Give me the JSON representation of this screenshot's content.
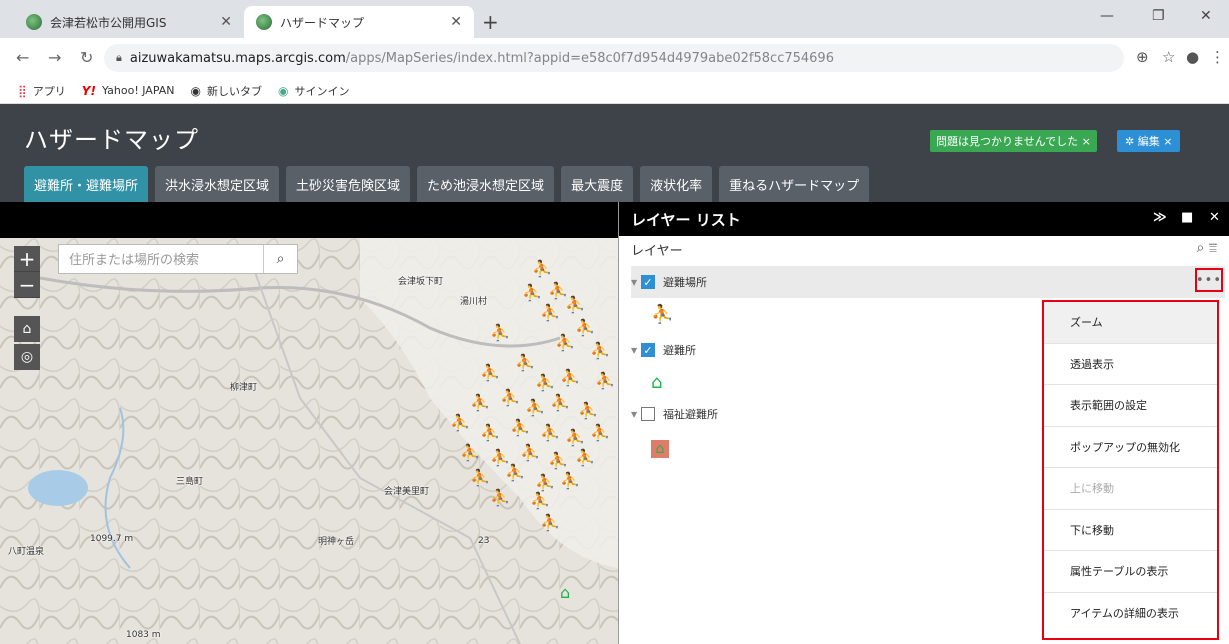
{
  "browser": {
    "tabs": [
      {
        "title": "会津若松市公開用GIS",
        "active": false
      },
      {
        "title": "ハザードマップ",
        "active": true
      }
    ],
    "url_host": "aizuwakamatsu.maps.arcgis.com",
    "url_path": "/apps/MapSeries/index.html?appid=e58c0f7d954d4979abe02f58cc754696",
    "bookmarks": [
      {
        "label": "アプリ",
        "icon": "apps-grid-icon"
      },
      {
        "label": "Yahoo! JAPAN",
        "icon": "yahoo-icon"
      },
      {
        "label": "新しいタブ",
        "icon": "globe-icon"
      },
      {
        "label": "サインイン",
        "icon": "globe-icon"
      }
    ]
  },
  "app": {
    "title": "ハザードマップ",
    "notice": "問題は見つかりませんでした ×",
    "edit_label": "編集 ×",
    "tabs": [
      {
        "label": "避難所・避難場所",
        "active": true
      },
      {
        "label": "洪水浸水想定区域",
        "active": false
      },
      {
        "label": "土砂災害危険区域",
        "active": false
      },
      {
        "label": "ため池浸水想定区域",
        "active": false
      },
      {
        "label": "最大震度",
        "active": false
      },
      {
        "label": "液状化率",
        "active": false
      },
      {
        "label": "重ねるハザードマップ",
        "active": false
      }
    ]
  },
  "map": {
    "search_placeholder": "住所または場所の検索",
    "place_labels": [
      {
        "text": "会津坂下町"
      },
      {
        "text": "湯川村"
      },
      {
        "text": "柳津町"
      },
      {
        "text": "会津美里町"
      },
      {
        "text": "三島町"
      },
      {
        "text": "八町温泉"
      },
      {
        "text": "1099.7 m"
      },
      {
        "text": "明神ヶ岳"
      },
      {
        "text": "1083 m"
      },
      {
        "text": "23"
      }
    ]
  },
  "panel": {
    "title": "レイヤー リスト",
    "subtitle": "レイヤー",
    "layers": [
      {
        "name": "避難場所",
        "checked": true
      },
      {
        "name": "避難所",
        "checked": true
      },
      {
        "name": "福祉避難所",
        "checked": false
      }
    ],
    "more_label": "•••",
    "menu": [
      {
        "label": "ズーム",
        "enabled": true
      },
      {
        "label": "透過表示",
        "enabled": true
      },
      {
        "label": "表示範囲の設定",
        "enabled": true
      },
      {
        "label": "ポップアップの無効化",
        "enabled": true
      },
      {
        "label": "上に移動",
        "enabled": false
      },
      {
        "label": "下に移動",
        "enabled": true
      },
      {
        "label": "属性テーブルの表示",
        "enabled": true
      },
      {
        "label": "アイテムの詳細の表示",
        "enabled": true
      }
    ]
  },
  "colors": {
    "header_bg": "#3e4349",
    "tab_active": "#3192a6",
    "tab_inactive": "#5a6068",
    "notice_green": "#3aa853",
    "edit_blue": "#2d8fd5",
    "highlight_red": "#e60012",
    "symbol_green": "#22b14c"
  }
}
